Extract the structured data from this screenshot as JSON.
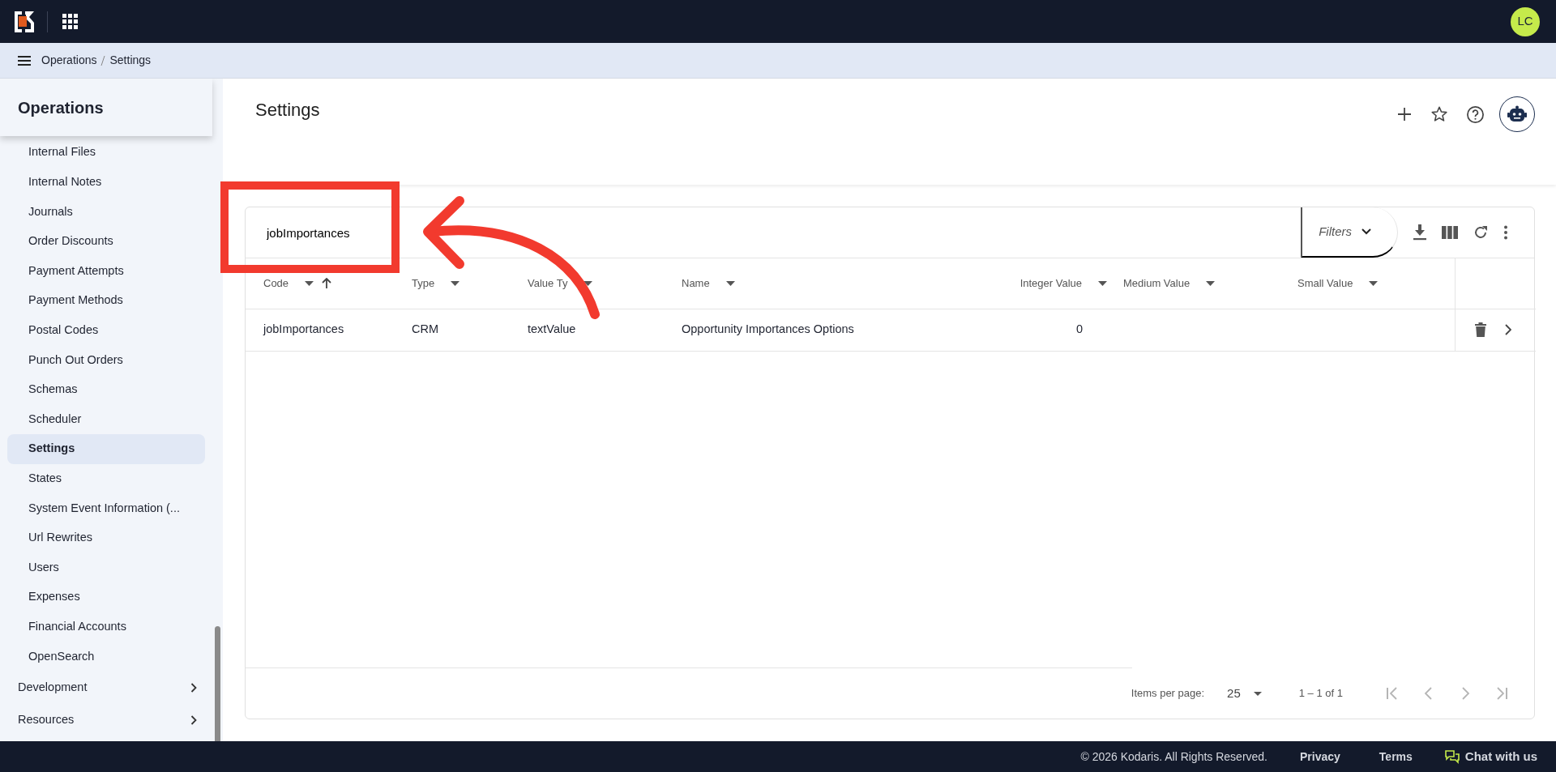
{
  "topbar": {
    "avatar": "LC"
  },
  "breadcrumb": [
    "Operations",
    "Settings"
  ],
  "sidebar": {
    "title": "Operations",
    "items": [
      {
        "label": "Internal Files",
        "selected": false
      },
      {
        "label": "Internal Notes",
        "selected": false
      },
      {
        "label": "Journals",
        "selected": false
      },
      {
        "label": "Order Discounts",
        "selected": false
      },
      {
        "label": "Payment Attempts",
        "selected": false
      },
      {
        "label": "Payment Methods",
        "selected": false
      },
      {
        "label": "Postal Codes",
        "selected": false
      },
      {
        "label": "Punch Out Orders",
        "selected": false
      },
      {
        "label": "Schemas",
        "selected": false
      },
      {
        "label": "Scheduler",
        "selected": false
      },
      {
        "label": "Settings",
        "selected": true
      },
      {
        "label": "States",
        "selected": false
      },
      {
        "label": "System Event Information (...",
        "selected": false
      },
      {
        "label": "Url Rewrites",
        "selected": false
      },
      {
        "label": "Users",
        "selected": false
      },
      {
        "label": "Expenses",
        "selected": false
      },
      {
        "label": "Financial Accounts",
        "selected": false
      },
      {
        "label": "OpenSearch",
        "selected": false
      }
    ],
    "groups": [
      {
        "label": "Development",
        "expanded": false
      },
      {
        "label": "Resources",
        "expanded": false
      }
    ]
  },
  "page": {
    "title": "Settings"
  },
  "search": {
    "value": "jobImportances"
  },
  "filters": {
    "label": "Filters"
  },
  "table": {
    "columns": [
      {
        "label": "Code",
        "sorted": true
      },
      {
        "label": "Type",
        "sorted": false
      },
      {
        "label": "Value Ty",
        "sorted": false
      },
      {
        "label": "Name",
        "sorted": false
      },
      {
        "label": "Integer Value",
        "sorted": false
      },
      {
        "label": "Medium Value",
        "sorted": false
      },
      {
        "label": "Small Value",
        "sorted": false
      }
    ],
    "rows": [
      {
        "code": "jobImportances",
        "type": "CRM",
        "value_type": "textValue",
        "name": "Opportunity Importances Options",
        "integer_value": "0"
      }
    ]
  },
  "paginator": {
    "label": "Items per page:",
    "page_size": "25",
    "range": "1 – 1 of 1",
    "buttons": [
      {
        "kind": "first",
        "disabled": true
      },
      {
        "kind": "prev",
        "disabled": true
      },
      {
        "kind": "next",
        "disabled": true
      },
      {
        "kind": "last",
        "disabled": true
      }
    ]
  },
  "footer": {
    "copyright": "© 2026 Kodaris. All Rights Reserved.",
    "links": [
      "Privacy",
      "Terms"
    ],
    "chat": "Chat with us"
  },
  "annotations": {
    "highlight_box": true,
    "pointer_arrow": true
  }
}
